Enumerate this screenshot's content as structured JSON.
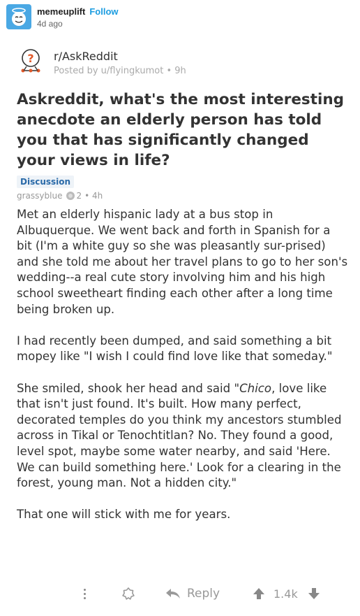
{
  "tumblr": {
    "username": "memeuplift",
    "follow_label": "Follow",
    "time": "4d ago"
  },
  "post": {
    "subreddit": "r/AskReddit",
    "posted_by": "Posted by u/flyingkumot • 9h",
    "title": "Askreddit, what's the most interesting anecdote an elderly person has told you that has significantly changed your views in life?",
    "flair": "Discussion"
  },
  "comment": {
    "author": "grassyblue",
    "award_count": "2",
    "time": "• 4h",
    "p1": "Met an elderly hispanic lady at a bus stop in Albuquerque. We went back and forth in Spanish for a bit (I'm a white guy so she was pleasantly sur-prised) and she told me about her travel plans to go to her son's wedding--a real cute story involving him and his high school sweetheart finding each other after a long time being broken up.",
    "p2": "I had recently been dumped, and said something a bit mopey like \"I wish I could find love like that someday.\"",
    "p3_before": "She smiled, shook her head and said \"",
    "p3_italic": "Chico",
    "p3_after": ", love like that isn't just found. It's built. How many perfect, decorated temples do you think my ancestors stumbled across in Tikal or Tenochtitlan? No. They found a good, level spot, maybe some water nearby, and said 'Here. We can build something here.' Look for a clearing in the forest, young man. Not a hidden city.\"",
    "p4": "That one will stick with me for years."
  },
  "actions": {
    "reply_label": "Reply",
    "vote_count": "1.4k"
  },
  "colors": {
    "tumblr_accent": "#1a9ce0",
    "avatar_bg": "#4aa8e4",
    "flair_text": "#2a6aa8"
  }
}
